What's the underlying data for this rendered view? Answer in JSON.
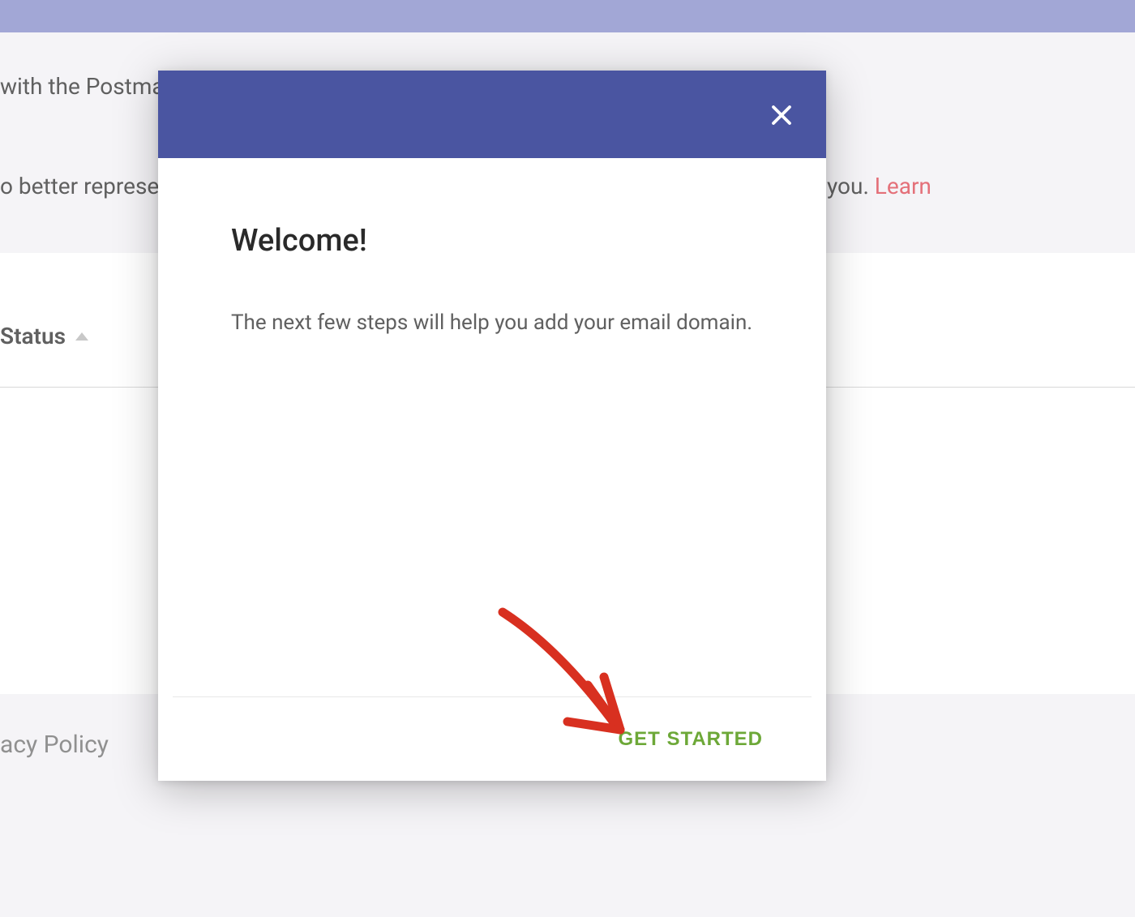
{
  "background": {
    "text1": "with the Postma",
    "text2_left": "o better represe",
    "text2_right_prefix": "you. ",
    "learn_link": "Learn",
    "status_header": "Status",
    "privacy_policy": "acy Policy"
  },
  "modal": {
    "title": "Welcome!",
    "body_text": "The next few steps will help you add your email domain.",
    "get_started_label": "GET STARTED"
  },
  "colors": {
    "modal_header": "#4a55a1",
    "accent_green": "#6da838",
    "link_red": "#e47079",
    "annotation_red": "#d83020"
  }
}
